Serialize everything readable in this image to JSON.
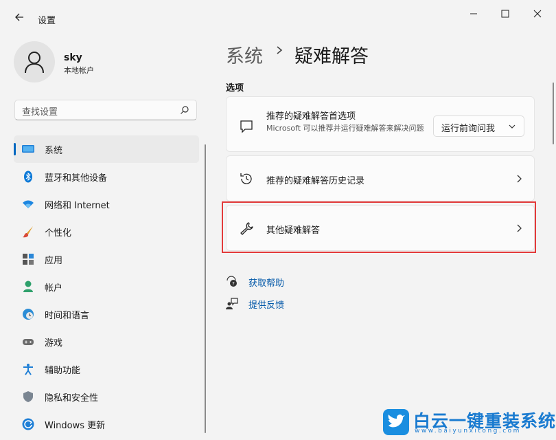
{
  "window": {
    "title": "设置"
  },
  "user": {
    "name": "sky",
    "account_type": "本地帐户"
  },
  "search": {
    "placeholder": "查找设置"
  },
  "nav": {
    "items": [
      {
        "label": "系统",
        "icon": "monitor-icon",
        "active": true
      },
      {
        "label": "蓝牙和其他设备",
        "icon": "bluetooth-icon"
      },
      {
        "label": "网络和 Internet",
        "icon": "wifi-icon"
      },
      {
        "label": "个性化",
        "icon": "brush-icon"
      },
      {
        "label": "应用",
        "icon": "apps-icon"
      },
      {
        "label": "帐户",
        "icon": "person-icon"
      },
      {
        "label": "时间和语言",
        "icon": "globe-clock-icon"
      },
      {
        "label": "游戏",
        "icon": "gamepad-icon"
      },
      {
        "label": "辅助功能",
        "icon": "accessibility-icon"
      },
      {
        "label": "隐私和安全性",
        "icon": "shield-icon"
      },
      {
        "label": "Windows 更新",
        "icon": "update-icon"
      }
    ]
  },
  "breadcrumb": {
    "parent": "系统",
    "current": "疑难解答"
  },
  "section_title": "选项",
  "cards": {
    "recommended": {
      "title": "推荐的疑难解答首选项",
      "description": "Microsoft 可以推荐并运行疑难解答来解决问题",
      "dropdown_value": "运行前询问我"
    },
    "history": {
      "title": "推荐的疑难解答历史记录"
    },
    "other": {
      "title": "其他疑难解答"
    }
  },
  "links": {
    "help": "获取帮助",
    "feedback": "提供反馈"
  },
  "watermark": {
    "text": "白云一键重装系统",
    "url": "www.baiyunxitong.com"
  },
  "colors": {
    "accent": "#0067c0",
    "highlight_box": "#e33a3a",
    "background": "#f3f3f3"
  }
}
